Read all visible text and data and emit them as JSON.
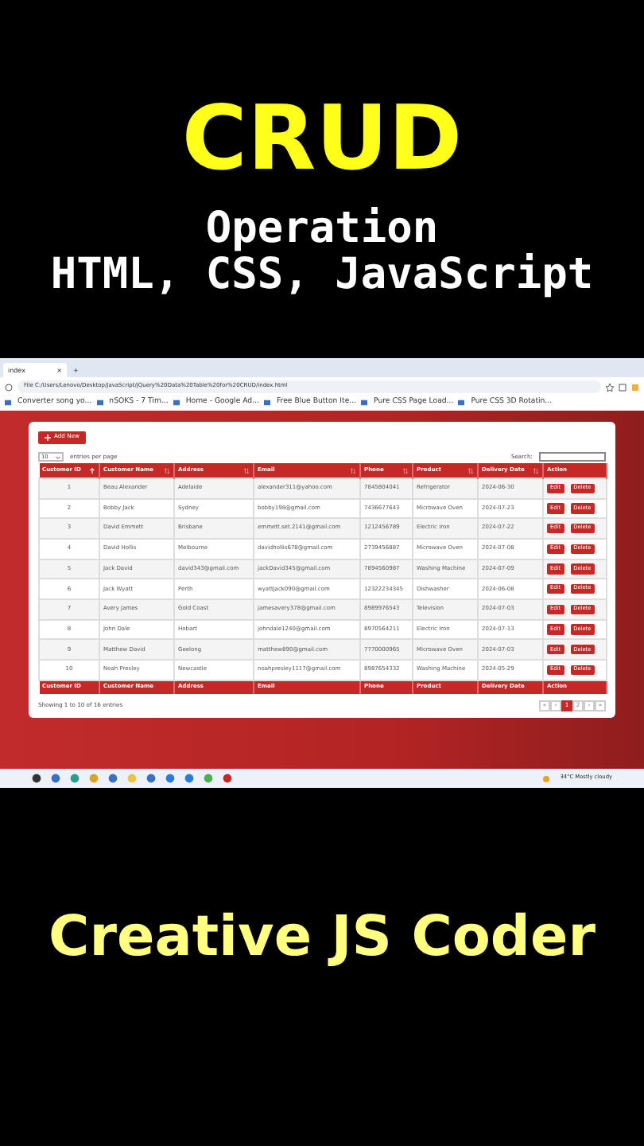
{
  "headline": {
    "title": "CRUD",
    "subtitle": "Operation",
    "tech": "HTML, CSS, JavaScript"
  },
  "browser": {
    "tab_title": "index",
    "tab_close": "×",
    "new_tab": "+",
    "address_prefix": "File",
    "address": "C:/Users/Lenovo/Desktop/JavaScript/jQuery%20Data%20Table%20for%20CRUD/index.html",
    "bookmarks": [
      "Converter song yo...",
      "nSOKS - 7 Tim...",
      "Home - Google Ad...",
      "Free Blue Button Ite...",
      "Pure CSS Page Load...",
      "Pure CSS 3D Rotatin..."
    ]
  },
  "app": {
    "add_button": "Add New",
    "page_length": "10",
    "page_length_label": "entries per page",
    "search_label": "Search:",
    "columns": [
      {
        "label": "Customer ID",
        "sorted": true
      },
      {
        "label": "Customer Name",
        "sorted": false
      },
      {
        "label": "Address",
        "sorted": false
      },
      {
        "label": "Email",
        "sorted": false
      },
      {
        "label": "Phone",
        "sorted": false
      },
      {
        "label": "Product",
        "sorted": false
      },
      {
        "label": "Delivery Date",
        "sorted": false
      },
      {
        "label": "Action"
      }
    ],
    "rows": [
      {
        "cells": [
          "1",
          "Beau Alexander",
          "Adelaide",
          "alexander311@yahoo.com",
          "7845804041",
          "Refrigerator",
          "2024-06-30"
        ]
      },
      {
        "cells": [
          "2",
          "Bobby Jack",
          "Sydney",
          "bobby198@gmail.com",
          "7436677643",
          "Microwave Oven",
          "2024-07-23"
        ]
      },
      {
        "cells": [
          "3",
          "David Emmett",
          "Brisbane",
          "emmett.set.2141@gmail.com",
          "1212456789",
          "Electric Iron",
          "2024-07-22"
        ]
      },
      {
        "cells": [
          "4",
          "David Hollis",
          "Melbourne",
          "davidhollis678@gmail.com",
          "2739456887",
          "Microwave Oven",
          "2024-07-08"
        ]
      },
      {
        "cells": [
          "5",
          "Jack David",
          "david343@gmail.com",
          "jackDavid345@gmail.com",
          "7894560987",
          "Washing Machine",
          "2024-07-09"
        ]
      },
      {
        "cells": [
          "6",
          "Jack Wyatt",
          "Perth",
          "wyattjack090@gmail.com",
          "12322234345",
          "Dishwasher",
          "2024-06-08"
        ]
      },
      {
        "cells": [
          "7",
          "Avery James",
          "Gold Coast",
          "jamesavery378@gmail.com",
          "8989976543",
          "Television",
          "2024-07-03"
        ]
      },
      {
        "cells": [
          "8",
          "John Dale",
          "Hobart",
          "johndale1240@gmail.com",
          "8970564211",
          "Electric Iron",
          "2024-07-13"
        ]
      },
      {
        "cells": [
          "9",
          "Matthew David",
          "Geelong",
          "matthew890@gmail.com",
          "7770000965",
          "Microwave Oven",
          "2024-07-03"
        ]
      },
      {
        "cells": [
          "10",
          "Noah Presley",
          "Newcastle",
          "noahpresley1117@gmail.com",
          "8987654332",
          "Washing Machine",
          "2024-05-29"
        ]
      }
    ],
    "actions": [
      {
        "edit": "Edit",
        "delete": "Delete"
      },
      {
        "edit": "Edit",
        "delete": "Delete"
      },
      {
        "edit": "Edit",
        "delete": "Delete"
      },
      {
        "edit": "Edit",
        "delete": "Delete"
      },
      {
        "edit": "Edit",
        "delete": "Delete"
      },
      {
        "edit": "Edit",
        "delete": "Delete"
      },
      {
        "edit": "Edit",
        "delete": "Delete"
      },
      {
        "edit": "Edit",
        "delete": "Delete"
      },
      {
        "edit": "Edit",
        "delete": "Delete"
      },
      {
        "edit": "Edit",
        "delete": "Delete"
      }
    ],
    "footer_columns": [
      "Customer ID",
      "Customer Name",
      "Address",
      "Email",
      "Phone",
      "Product",
      "Delivery Date",
      "Action"
    ],
    "info": "Showing 1 to 10 of 16 entries",
    "pagination": [
      {
        "label": "«",
        "selected": false
      },
      {
        "label": "‹",
        "selected": false
      },
      {
        "label": "1",
        "selected": true
      },
      {
        "label": "2",
        "selected": false
      },
      {
        "label": "›",
        "selected": false
      },
      {
        "label": "»",
        "selected": false
      }
    ]
  },
  "taskbar": {
    "weather": "34°C Mostly cloudy"
  },
  "footer_title": "Creative JS Coder"
}
